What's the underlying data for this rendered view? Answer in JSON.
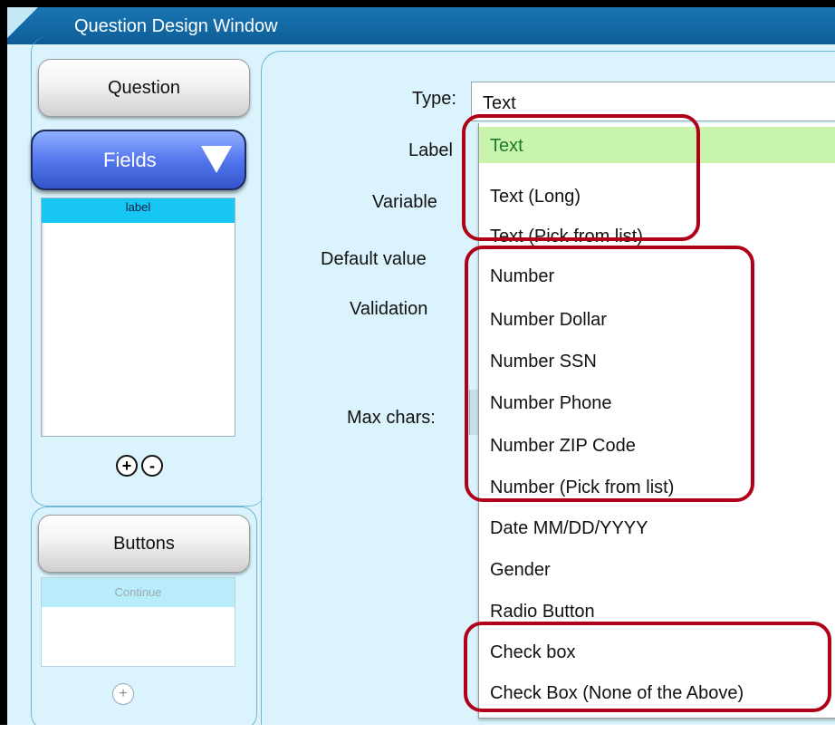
{
  "window": {
    "title": "Question Design Window"
  },
  "left": {
    "question_label": "Question",
    "fields_label": "Fields",
    "fields_list": [
      "label"
    ],
    "add_symbol": "+",
    "remove_symbol": "-",
    "buttons_label": "Buttons",
    "buttons_list": [
      "Continue"
    ]
  },
  "form": {
    "type_label": "Type:",
    "type_value": "Text",
    "label_label": "Label",
    "variable_label": "Variable",
    "default_label": "Default value",
    "validation_label": "Validation",
    "maxchars_label": "Max chars:"
  },
  "dropdown": {
    "selected_index": 0,
    "options": [
      "Text",
      "Text (Long)",
      "Text (Pick from list)",
      "Number",
      "Number Dollar",
      "Number SSN",
      "Number Phone",
      "Number ZIP Code",
      "Number (Pick from list)",
      "Date MM/DD/YYYY",
      "Gender",
      "Radio Button",
      "Check box",
      "Check Box (None of the Above)"
    ]
  },
  "colors": {
    "highlight": "#b00018",
    "selected_bg": "#c9f4ab",
    "titlebar": "#0d5e97",
    "fields_button": "#5577ee"
  }
}
